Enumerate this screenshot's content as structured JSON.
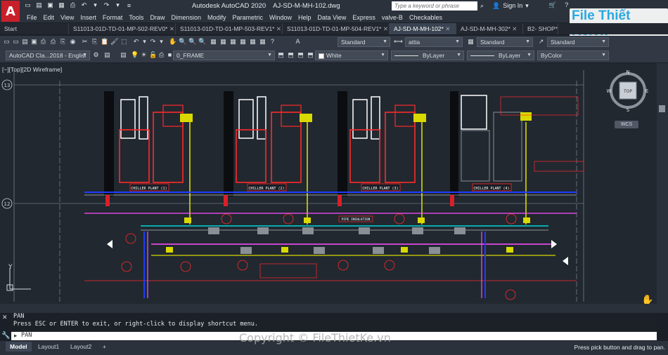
{
  "window": {
    "app_title": "Autodesk AutoCAD 2020",
    "file_name": "AJ-SD-M-MH-102.dwg",
    "search_placeholder": "Type a keyword or phrase",
    "sign_in": "Sign In"
  },
  "logo_letter": "A",
  "brand_watermark": "File Thiết Kế.vn",
  "menu": [
    "File",
    "Edit",
    "View",
    "Insert",
    "Format",
    "Tools",
    "Draw",
    "Dimension",
    "Modify",
    "Parametric",
    "Window",
    "Help",
    "Data View",
    "Express",
    "valve-B",
    "Checkables"
  ],
  "doc_tabs": [
    {
      "label": "Start",
      "active": false
    },
    {
      "label": "S11013-01D-TD-01-MP-502-REV0*",
      "active": false
    },
    {
      "label": "S11013-01D-TD-01-MP-503-REV1*",
      "active": false
    },
    {
      "label": "S11013-01D-TD-01-MP-504-REV1*",
      "active": false
    },
    {
      "label": "AJ-SD-M-MH-102*",
      "active": true
    },
    {
      "label": "AJ-SD-M-MH-302*",
      "active": false
    },
    {
      "label": "B2- SHOP*",
      "active": false
    }
  ],
  "toolbar": {
    "workspace": "AutoCAD Cla...2018 - Englisl",
    "text_style": "Standard",
    "dim_style": "attia",
    "table_style": "Standard",
    "mleader_style": "Standard",
    "layer": "0_FRAME",
    "color": "White",
    "linetype": "ByLayer",
    "lineweight": "ByLayer",
    "plotstyle": "ByColor"
  },
  "viewport": {
    "label": "[−][Top][2D Wireframe]",
    "viewcube": {
      "n": "N",
      "s": "S",
      "e": "E",
      "w": "W",
      "face": "TOP",
      "ucs": "WCS"
    },
    "grid_marks": [
      "13",
      "12"
    ]
  },
  "drawing_labels": {
    "chiller_1": "CHILLER PLANT (1)",
    "chiller_2": "CHILLER PLANT (2)",
    "chiller_3": "CHILLER PLANT (3)",
    "chiller_4": "CHILLER PLANT (4)",
    "pipe_insulation": "PIPE INSULATION"
  },
  "command": {
    "history_1": "PAN",
    "history_2": "Press ESC or ENTER to exit, or right-click to display shortcut menu.",
    "prompt": "PAN",
    "input_value": ""
  },
  "layout_tabs": [
    "Model",
    "Layout1",
    "Layout2",
    "+"
  ],
  "status_message": "Press pick button and drag to pan.",
  "watermark": "Copyright © FileThietKe.vn",
  "colors": {
    "accent_red": "#c8202a",
    "canvas_bg": "#212830",
    "brand_blue": "#2aa9e0"
  }
}
